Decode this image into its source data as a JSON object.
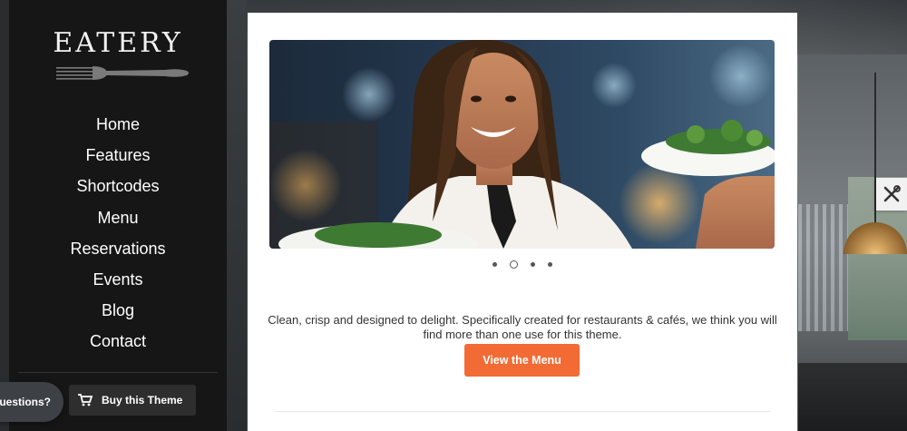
{
  "brand": {
    "name": "EATERY"
  },
  "nav": {
    "items": [
      {
        "label": "Home"
      },
      {
        "label": "Features"
      },
      {
        "label": "Shortcodes"
      },
      {
        "label": "Menu"
      },
      {
        "label": "Reservations"
      },
      {
        "label": "Events"
      },
      {
        "label": "Blog"
      },
      {
        "label": "Contact"
      }
    ]
  },
  "sidebar": {
    "buy_label": "Buy this Theme",
    "questions_label": "uestions?"
  },
  "main": {
    "slider": {
      "slide_count": 4,
      "active_index": 1
    },
    "tagline": "Clean, crisp and designed to delight. Specifically created for restaurants & cafés, we think you will find more than one use for this theme.",
    "cta_label": "View the Menu"
  },
  "colors": {
    "accent": "#f26b34",
    "sidebar": "#161616",
    "card": "#ffffff"
  },
  "icons": {
    "logo": "fork-icon",
    "buy": "cart-icon",
    "settings": "tools-icon"
  }
}
